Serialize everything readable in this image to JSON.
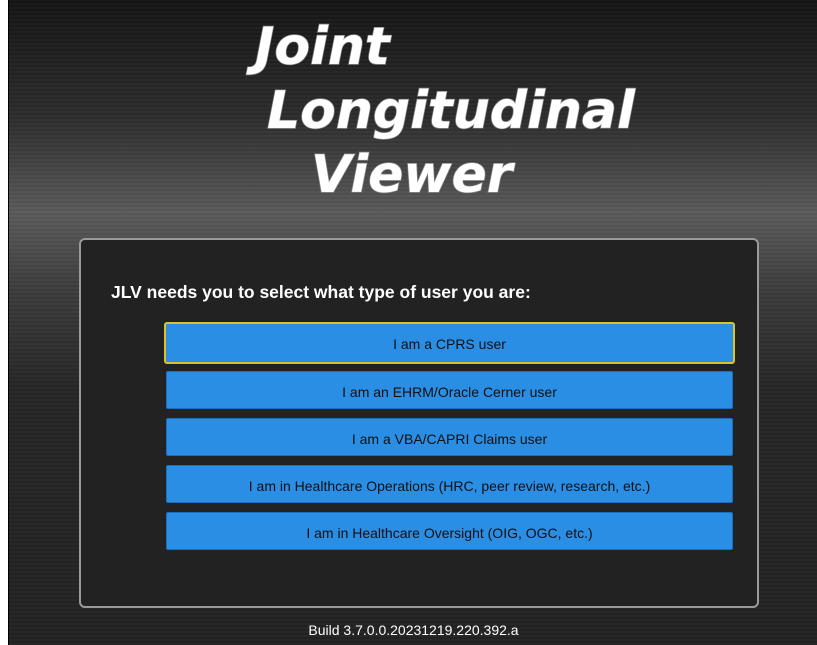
{
  "logo": {
    "line1": "Joint",
    "line2": "Longitudinal",
    "line3": "Viewer"
  },
  "prompt": "JLV needs you to select what type of user you are:",
  "options": [
    {
      "label": "I am a CPRS user",
      "focused": true
    },
    {
      "label": "I am an EHRM/Oracle Cerner user",
      "focused": false
    },
    {
      "label": "I am a VBA/CAPRI Claims user",
      "focused": false
    },
    {
      "label": "I am in Healthcare Operations (HRC, peer review, research, etc.)",
      "focused": false
    },
    {
      "label": "I am in Healthcare Oversight (OIG, OGC, etc.)",
      "focused": false
    }
  ],
  "build": "Build 3.7.0.0.20231219.220.392.a",
  "colors": {
    "button": "#2b8ee5",
    "focus_ring": "#e0c028",
    "panel": "#222222",
    "panel_border": "#9a9a9a"
  }
}
